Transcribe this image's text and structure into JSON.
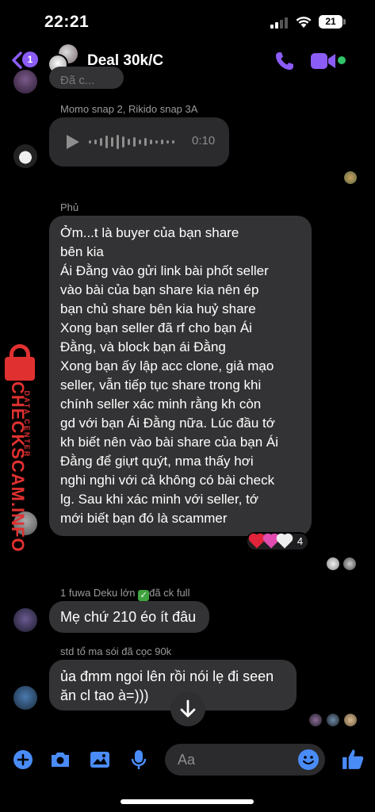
{
  "status_bar": {
    "time": "22:21",
    "battery": "21"
  },
  "header": {
    "back_count": "1",
    "title": "Deal 30k/C",
    "accent_color": "#8b5cf6"
  },
  "messages": {
    "partial_top_text": "Đã c...",
    "voice": {
      "sender": "Momo snap 2, Rikido snap 3A",
      "duration": "0:10"
    },
    "long": {
      "sender": "Phủ",
      "lines": [
        "Ởm...t là buyer của bạn share",
        "bên kia",
        "Ái Đằng vào gửi link bài phốt seller",
        "vào bài của bạn share kia nên ép",
        "bạn chủ share bên kia huỷ share",
        "Xong bạn seller đã rf cho bạn Ái",
        "Đằng, và block bạn ái Đằng",
        "Xong bạn ấy lập acc clone, giả mạo",
        "seller, vẫn tiếp tục share trong khi",
        "chính seller xác minh rằng kh còn",
        "gd với bạn Ái Đằng nữa. Lúc đầu tớ",
        "kh biết nên vào bài share của bạn Ái",
        "Đằng để giựt quýt, nma thấy hơi",
        "nghi nghi với cả không có bài check",
        "lg. Sau khi xác minh với seller, tớ",
        "mới biết bạn đó là scammer"
      ],
      "reaction_count": "4"
    },
    "m3": {
      "sender_prefix": "1 fuwa Deku lớn",
      "sender_suffix": "đã ck full",
      "text": "Mẹ chứ 210 éo ít đâu"
    },
    "m4": {
      "sender": "std tổ ma sói đã cọc 90k",
      "line1": "ủa đmm ngoi lên rồi nói lẹ đi seen",
      "line2": "ăn cl tao à=)))"
    }
  },
  "watermark": {
    "brand": "CHECKSCAM.INFO",
    "sub": "DATA CENTER"
  },
  "composer": {
    "placeholder": "Aa"
  }
}
